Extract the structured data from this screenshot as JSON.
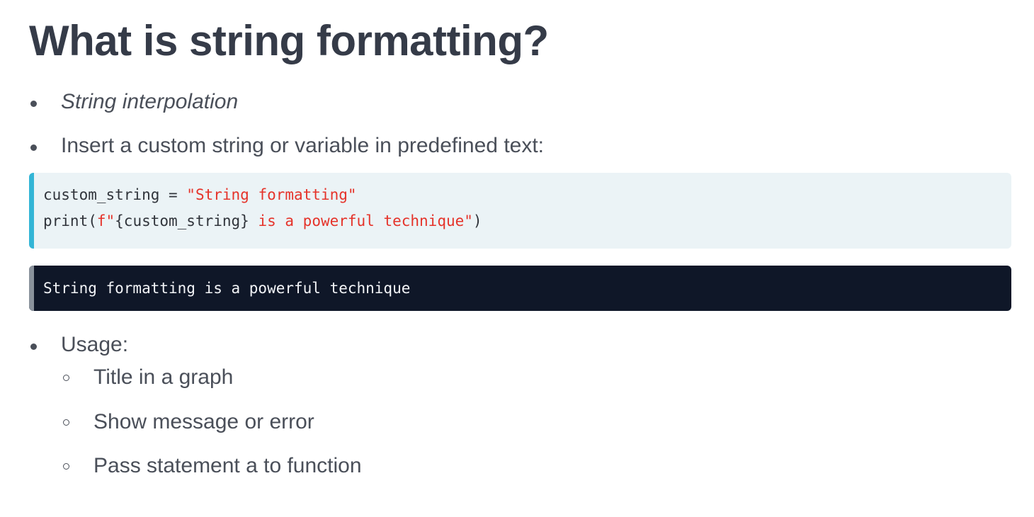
{
  "slide": {
    "title": "What is string formatting?",
    "bullets": [
      {
        "text": "String interpolation",
        "style": "italic"
      },
      {
        "text": "Insert a custom string or variable in predefined text:"
      },
      {
        "text": "Usage:"
      }
    ],
    "code": {
      "line1": {
        "plain": "custom_string = ",
        "string": "\"String formatting\""
      },
      "line2": {
        "prefix": "print(",
        "fstring_start": "f\"",
        "interp": "{custom_string}",
        "fstring_rest": " is a powerful technique\"",
        "suffix": ")"
      }
    },
    "output": {
      "text": "String formatting is a powerful technique"
    },
    "usage_items": [
      "Title in a graph",
      "Show message or error",
      "Pass statement a to function"
    ]
  },
  "colors": {
    "title": "#353b48",
    "body_text": "#4a4f59",
    "code_background": "#ebf3f6",
    "code_accent": "#33b5d6",
    "code_string": "#e5332a",
    "output_background": "#0f1728",
    "output_accent": "#8a929c",
    "output_text": "#f2f4f7"
  }
}
